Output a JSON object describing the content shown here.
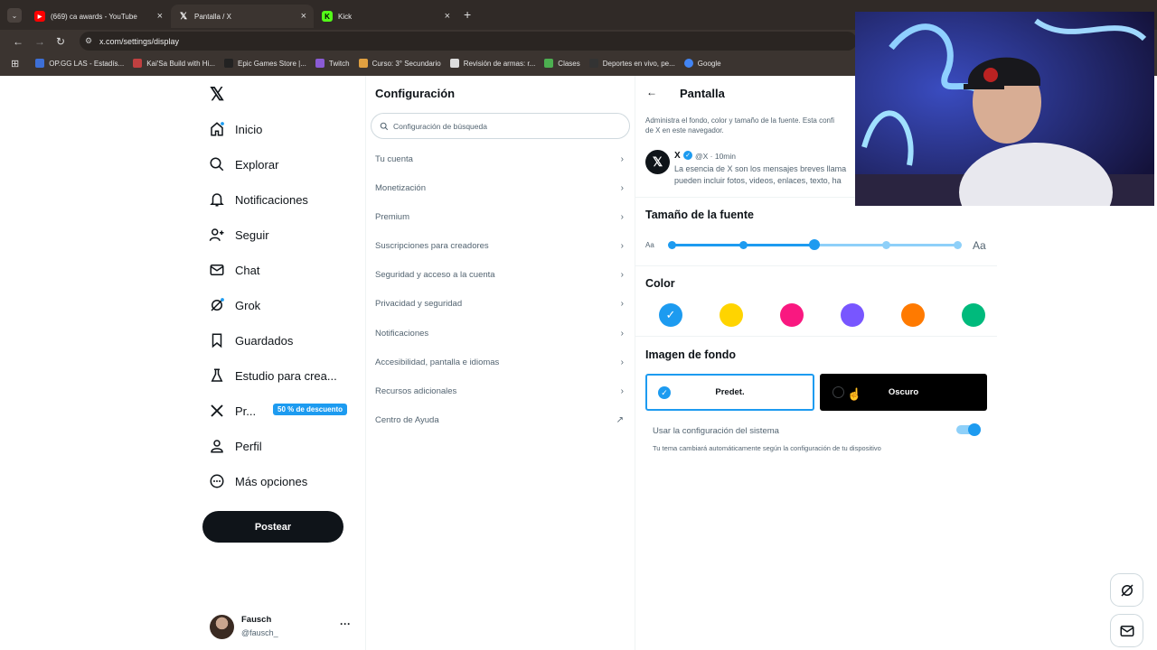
{
  "browser": {
    "tabs": [
      {
        "title": "(669) ca awards - YouTube",
        "icon": "youtube-icon"
      },
      {
        "title": "Pantalla / X",
        "icon": "x-logo-icon"
      },
      {
        "title": "Kick",
        "icon": "kick-icon"
      }
    ],
    "url": "x.com/settings/display",
    "bookmarks": [
      {
        "label": "OP.GG LAS - Estadís...",
        "color": "#3d6fd6"
      },
      {
        "label": "Kai'Sa Build with Hi...",
        "color": "#c04040"
      },
      {
        "label": "Epic Games Store |...",
        "color": "#222222"
      },
      {
        "label": "Twitch",
        "color": "#8a5bd4"
      },
      {
        "label": "Curso: 3° Secundario",
        "color": "#e0a040"
      },
      {
        "label": "Revisión de armas: r...",
        "color": "#dddddd"
      },
      {
        "label": "Clases",
        "color": "#4caf50"
      },
      {
        "label": "Deportes en vivo, pe...",
        "color": "#333333"
      },
      {
        "label": "Google",
        "color": "#4285f4"
      }
    ]
  },
  "nav": {
    "items": [
      {
        "label": "Inicio",
        "icon": "home-icon"
      },
      {
        "label": "Explorar",
        "icon": "search-icon"
      },
      {
        "label": "Notificaciones",
        "icon": "bell-icon"
      },
      {
        "label": "Seguir",
        "icon": "follow-icon"
      },
      {
        "label": "Chat",
        "icon": "mail-icon"
      },
      {
        "label": "Grok",
        "icon": "grok-icon"
      },
      {
        "label": "Guardados",
        "icon": "bookmark-icon"
      },
      {
        "label": "Estudio para crea...",
        "icon": "flask-icon"
      },
      {
        "label": "Pr...",
        "icon": "x-logo-icon"
      },
      {
        "label": "Perfil",
        "icon": "person-icon"
      },
      {
        "label": "Más opciones",
        "icon": "more-circle-icon"
      }
    ],
    "promo": "50 % de descuento",
    "post_label": "Postear",
    "profile": {
      "name": "Fausch",
      "handle": "@fausch_",
      "more": "···"
    }
  },
  "settings": {
    "title": "Configuración",
    "search_placeholder": "Configuración de búsqueda",
    "items": [
      "Tu cuenta",
      "Monetización",
      "Premium",
      "Suscripciones para creadores",
      "Seguridad y acceso a la cuenta",
      "Privacidad y seguridad",
      "Notificaciones",
      "Accesibilidad, pantalla e idiomas",
      "Recursos adicionales",
      "Centro de Ayuda"
    ]
  },
  "display": {
    "title": "Pantalla",
    "description_line1": "Administra el fondo, color y tamaño de la fuente. Esta confi",
    "description_line2": "de X en este navegador.",
    "preview": {
      "name": "X",
      "meta": "@X · 10min",
      "text_line1": "La esencia de X son los mensajes breves llama",
      "text_line2": "pueden incluir fotos, videos, enlaces, texto, ha"
    },
    "font_size": {
      "title": "Tamaño de la fuente",
      "small": "Aa",
      "large": "Aa",
      "selected_step": 3,
      "steps": 5
    },
    "color": {
      "title": "Color",
      "swatches": [
        "#1d9bf0",
        "#ffd400",
        "#f91880",
        "#7856ff",
        "#ff7a00",
        "#00ba7c"
      ],
      "selected": 0
    },
    "background": {
      "title": "Imagen de fondo",
      "options": [
        "Predet.",
        "Oscuro"
      ],
      "selected": 0
    },
    "system": {
      "label": "Usar la configuración del sistema",
      "hint": "Tu tema cambiará automáticamente según la configuración de tu dispositivo",
      "enabled": true
    }
  }
}
